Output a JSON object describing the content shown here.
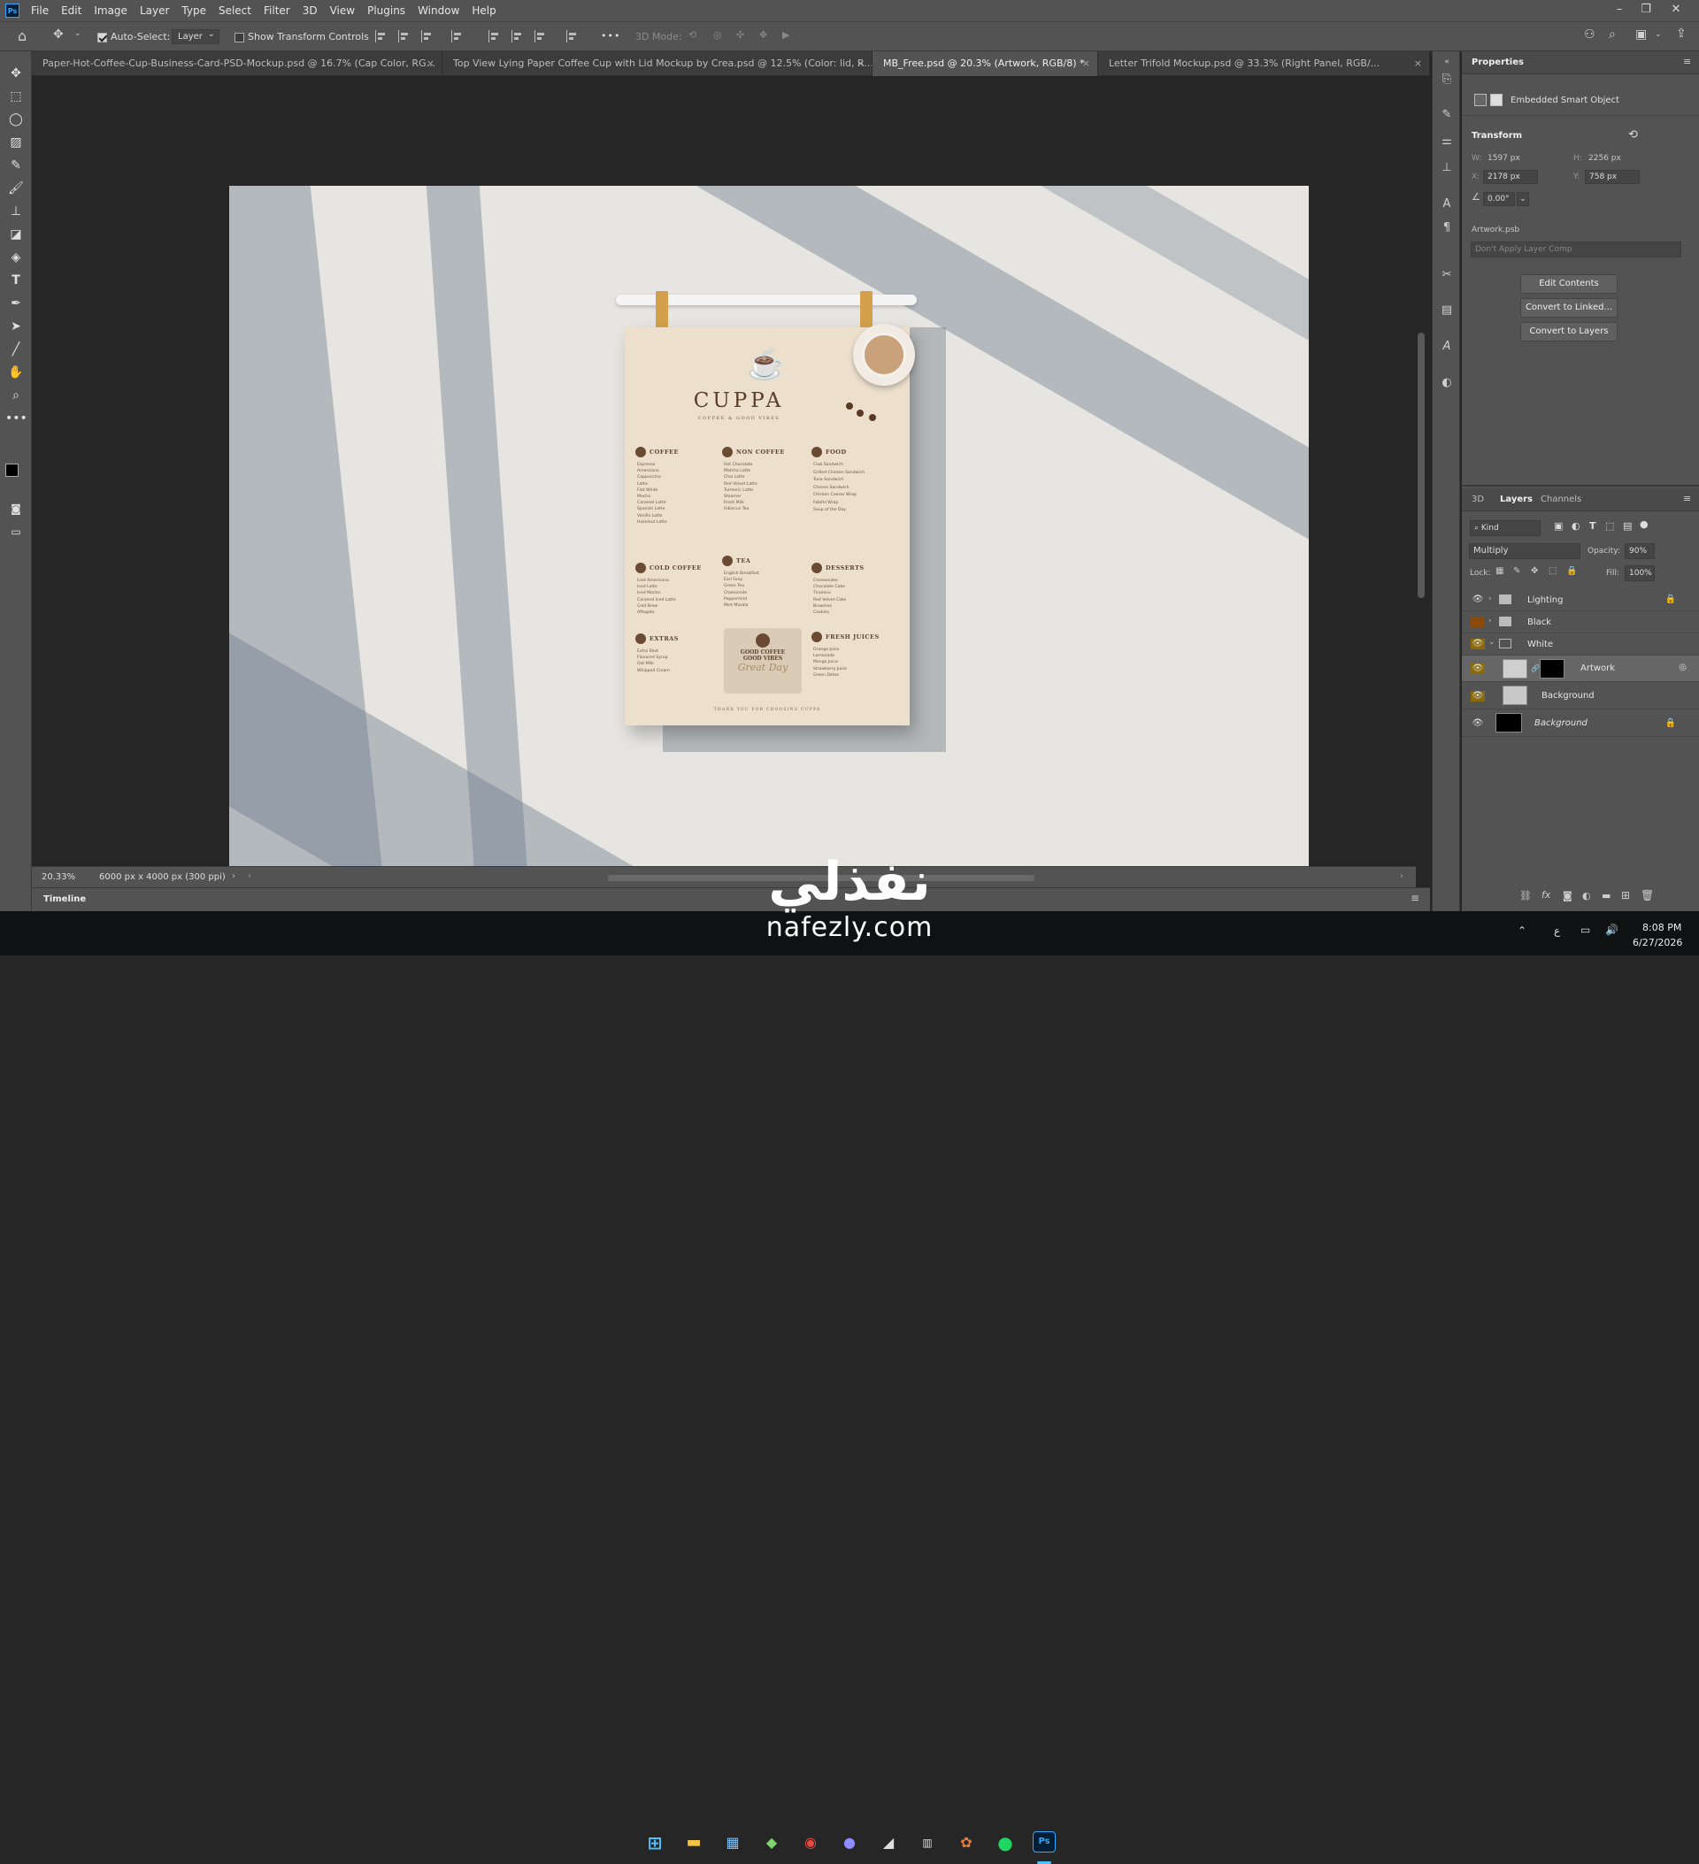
{
  "app": {
    "logo": "Ps"
  },
  "menu": [
    "File",
    "Edit",
    "Image",
    "Layer",
    "Type",
    "Select",
    "Filter",
    "3D",
    "View",
    "Plugins",
    "Window",
    "Help"
  ],
  "window_controls": {
    "minimize": "–",
    "restore": "❐",
    "close": "✕"
  },
  "options_bar": {
    "auto_select_label": "Auto-Select:",
    "auto_select_checked": true,
    "auto_select_target": "Layer",
    "show_transform_label": "Show Transform Controls",
    "three_d_mode_label": "3D Mode:",
    "more": "•••"
  },
  "tabs": [
    {
      "label": "Paper-Hot-Coffee-Cup-Business-Card-PSD-Mockup.psd @ 16.7% (Cap Color, RG...",
      "active": false
    },
    {
      "label": "Top View Lying Paper Coffee Cup with Lid Mockup by Crea.psd @ 12.5% (Color: lid, R...",
      "active": false
    },
    {
      "label": "MB_Free.psd @ 20.3% (Artwork, RGB/8) *",
      "active": true
    },
    {
      "label": "Letter Trifold Mockup.psd @ 33.3% (Right Panel, RGB/...",
      "active": false
    }
  ],
  "menu_paper": {
    "brand": "CUPPA",
    "tagline": "COFFEE & GOOD VIBES",
    "sections": {
      "coffee": {
        "title": "COFFEE",
        "items": [
          "Espresso",
          "Americano",
          "Cappuccino",
          "Latte",
          "Flat White",
          "Mocha",
          "Caramel Latte",
          "Spanish Latte",
          "Vanilla Latte",
          "Hazelnut Latte"
        ]
      },
      "non_coffee": {
        "title": "NON COFFEE",
        "items": [
          "Hot Chocolate",
          "Matcha Latte",
          "Chai Latte",
          "Red Velvet Latte",
          "Turmeric Latte",
          "Steamer",
          "Fresh Milk",
          "Hibiscus Tea"
        ]
      },
      "food": {
        "title": "FOOD",
        "items": [
          "Club Sandwich",
          "Grilled Chicken Sandwich",
          "Tuna Sandwich",
          "Cheese Sandwich",
          "Chicken Caesar Wrap",
          "Falafel Wrap",
          "Soup of the Day"
        ]
      },
      "cold_coffee": {
        "title": "COLD COFFEE",
        "items": [
          "Iced Americano",
          "Iced Latte",
          "Iced Mocha",
          "Caramel Iced Latte",
          "Cold Brew",
          "Affogato"
        ]
      },
      "tea": {
        "title": "TEA",
        "items": [
          "English Breakfast",
          "Earl Grey",
          "Green Tea",
          "Chamomile",
          "Peppermint",
          "Mint Masala"
        ]
      },
      "desserts": {
        "title": "DESSERTS",
        "items": [
          "Cheesecake",
          "Chocolate Cake",
          "Tiramisu",
          "Red Velvet Cake",
          "Brownies",
          "Cookies"
        ]
      },
      "extras": {
        "title": "EXTRAS",
        "items": [
          "Extra Shot",
          "Flavored Syrup",
          "Oat Milk",
          "Whipped Cream"
        ]
      },
      "fresh_juices": {
        "title": "FRESH JUICES",
        "items": [
          "Orange Juice",
          "Lemonade",
          "Mango Juice",
          "Strawberry Juice",
          "Green Detox"
        ]
      }
    },
    "badge_line1": "GOOD COFFEE",
    "badge_line2": "GOOD VIBES",
    "badge_script": "Great Day",
    "footer": "THANK YOU FOR CHOOSING CUPPA"
  },
  "status": {
    "zoom": "20.33%",
    "doc_info": "6000 px x 4000 px (300 ppi)",
    "timeline": "Timeline"
  },
  "properties": {
    "title": "Properties",
    "object_type": "Embedded Smart Object",
    "transform_title": "Transform",
    "w_label": "W:",
    "w": "1597 px",
    "h_label": "H:",
    "h": "2256 px",
    "x_label": "X:",
    "x": "2178 px",
    "y_label": "Y:",
    "y": "758 px",
    "angle": "0.00°",
    "file": "Artwork.psb",
    "layer_comp": "Don't Apply Layer Comp",
    "buttons": [
      "Edit Contents",
      "Convert to Linked...",
      "Convert to Layers"
    ]
  },
  "layers_panel": {
    "tabs": [
      "3D",
      "Layers",
      "Channels"
    ],
    "active_tab": "Layers",
    "kind_label": "Kind",
    "blend_mode": "Multiply",
    "opacity_label": "Opacity:",
    "opacity": "90%",
    "lock_label": "Lock:",
    "fill_label": "Fill:",
    "fill": "100%",
    "layers": [
      {
        "name": "Lighting",
        "type": "group",
        "visible": true,
        "locked": true,
        "indent": 0
      },
      {
        "name": "Black",
        "type": "group",
        "visible": false,
        "locked": false,
        "indent": 0
      },
      {
        "name": "White",
        "type": "group",
        "visible": true,
        "locked": false,
        "indent": 0,
        "expanded": true
      },
      {
        "name": "Artwork",
        "type": "smart",
        "visible": true,
        "locked": false,
        "indent": 1,
        "selected": true
      },
      {
        "name": "Background",
        "type": "image",
        "visible": true,
        "locked": false,
        "indent": 1
      },
      {
        "name": "Background",
        "type": "background",
        "visible": true,
        "locked": true,
        "indent": 0
      }
    ]
  },
  "taskbar": {
    "time": "8:08 PM",
    "date": "6/27/2026",
    "lang": "ع",
    "apps": [
      "start-icon",
      "file-explorer-icon",
      "store-icon",
      "app-icon",
      "chrome-icon",
      "app-icon",
      "app-icon",
      "app-icon",
      "app-icon",
      "spotify-icon",
      "photoshop-icon"
    ]
  },
  "watermark": {
    "arabic": "نفذلي",
    "latin": "nafezly.com"
  },
  "colors": {
    "accent": "#31a8ff",
    "panel": "#535353",
    "canvas_bg": "#262626",
    "eye_on": "#8a6a0a",
    "selected_layer": "#666666"
  }
}
